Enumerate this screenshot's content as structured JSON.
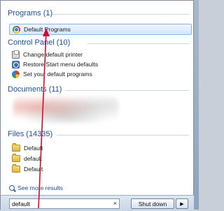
{
  "sections": {
    "programs": {
      "heading": "Programs (1)",
      "items": [
        {
          "label": "Default Programs",
          "icon": "default-programs-icon",
          "selected": true
        }
      ]
    },
    "control_panel": {
      "heading": "Control Panel (10)",
      "items": [
        {
          "label": "Change default printer",
          "icon": "printer-icon"
        },
        {
          "label": "Restore Start menu defaults",
          "icon": "restore-icon"
        },
        {
          "label": "Set your default programs",
          "icon": "default-programs-icon"
        }
      ]
    },
    "documents": {
      "heading": "Documents (11)"
    },
    "files": {
      "heading": "Files (14335)",
      "items": [
        {
          "label": "Default",
          "icon": "folder-icon"
        },
        {
          "label": "default",
          "icon": "folder-icon"
        },
        {
          "label": "Default",
          "icon": "folder-icon"
        }
      ]
    }
  },
  "see_more": {
    "label": "See more results",
    "icon": "search-icon"
  },
  "search": {
    "value": "default",
    "clear_glyph": "×"
  },
  "shutdown": {
    "label": "Shut down",
    "arrow_glyph": "▶"
  },
  "colors": {
    "heading": "#1f4fa0",
    "selection_border": "#8bb4e6",
    "annotation_arrow": "#d0102a"
  }
}
